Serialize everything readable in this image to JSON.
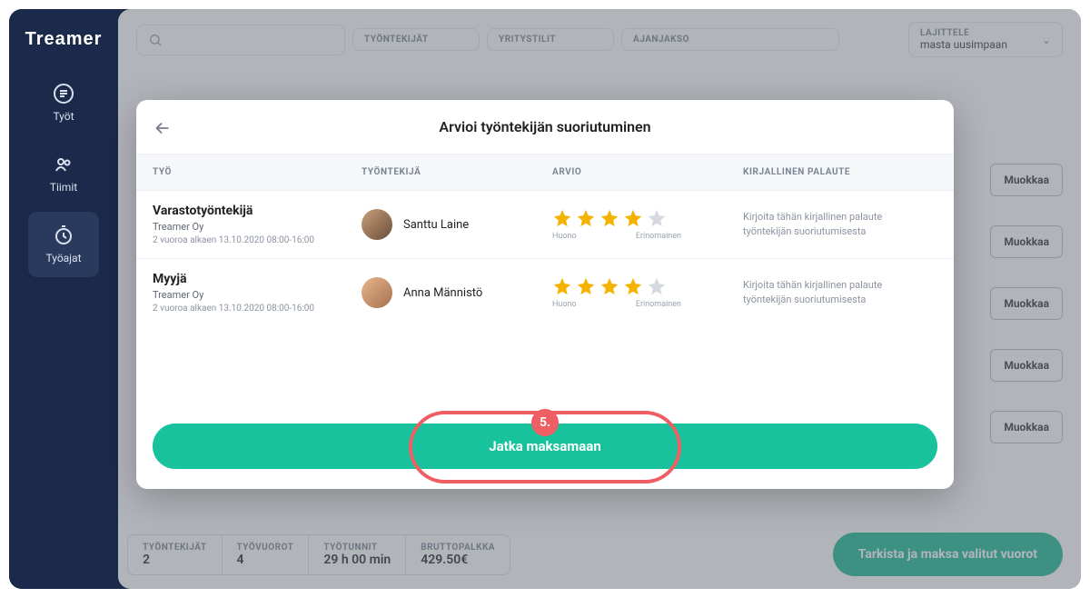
{
  "brand": "Treamer",
  "sidebar": {
    "items": [
      {
        "label": "Työt"
      },
      {
        "label": "Tiimit"
      },
      {
        "label": "Työajat"
      }
    ]
  },
  "filters": {
    "employees_label": "TYÖNTEKIJÄT",
    "accounts_label": "YRITYSTILIT",
    "period_label": "AJANJAKSO",
    "sort_label": "LAJITTELE",
    "sort_value": "masta uusimpaan"
  },
  "edit_label": "Muokkaa",
  "summary": {
    "cells": [
      {
        "label": "TYÖNTEKIJÄT",
        "value": "2"
      },
      {
        "label": "TYÖVUOROT",
        "value": "4"
      },
      {
        "label": "TYÖTUNNIT",
        "value": "29 h 00 min"
      },
      {
        "label": "BRUTTOPALKKA",
        "value": "429.50€"
      }
    ],
    "action": "Tarkista ja maksa valitut vuorot"
  },
  "modal": {
    "title": "Arvioi työntekijän suoriutuminen",
    "columns": {
      "job": "TYÖ",
      "worker": "TYÖNTEKIJÄ",
      "rating": "ARVIO",
      "feedback": "KIRJALLINEN PALAUTE"
    },
    "rating_min": "Huono",
    "rating_max": "Erinomainen",
    "feedback_placeholder": "Kirjoita tähän kirjallinen palaute työntekijän suoriutumisesta",
    "rows": [
      {
        "job": "Varastotyöntekijä",
        "company": "Treamer Oy",
        "detail": "2 vuoroa alkaen 13.10.2020 08:00-16:00",
        "worker": "Santtu Laine",
        "stars": 4
      },
      {
        "job": "Myyjä",
        "company": "Treamer Oy",
        "detail": "2 vuoroa alkaen 13.10.2020 08:00-16:00",
        "worker": "Anna Männistö",
        "stars": 4
      }
    ],
    "continue": "Jatka maksamaan",
    "callout_number": "5."
  }
}
